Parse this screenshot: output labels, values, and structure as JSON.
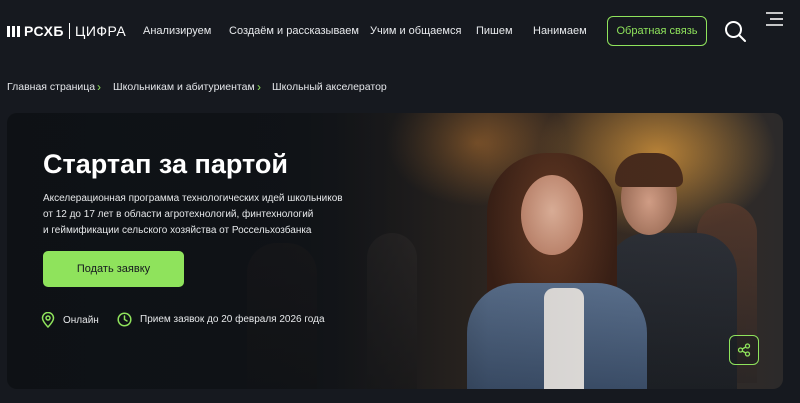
{
  "logo": {
    "brand": "РСХБ",
    "sub": "ЦИФРА"
  },
  "nav": {
    "items": [
      {
        "label": "Анализируем"
      },
      {
        "label": "Создаём и рассказываем"
      },
      {
        "label": "Учим и общаемся"
      },
      {
        "label": "Пишем"
      },
      {
        "label": "Нанимаем"
      }
    ],
    "feedback_label": "Обратная связь"
  },
  "breadcrumbs": [
    {
      "label": "Главная страница"
    },
    {
      "label": "Школьникам и абитуриентам"
    },
    {
      "label": "Школьный акселератор"
    }
  ],
  "hero": {
    "title": "Стартап за партой",
    "description_lines": [
      "Акселерационная программа технологических идей школьников",
      "от 12 до 17 лет в области агротехнологий, финтехнологий",
      "и геймификации сельского хозяйства от Россельхозбанка"
    ],
    "apply_label": "Подать заявку",
    "format_label": "Онлайн",
    "deadline_label": "Прием заявок до 20 февраля 2026 года"
  },
  "colors": {
    "accent": "#8fe35c",
    "background": "#16191f"
  }
}
